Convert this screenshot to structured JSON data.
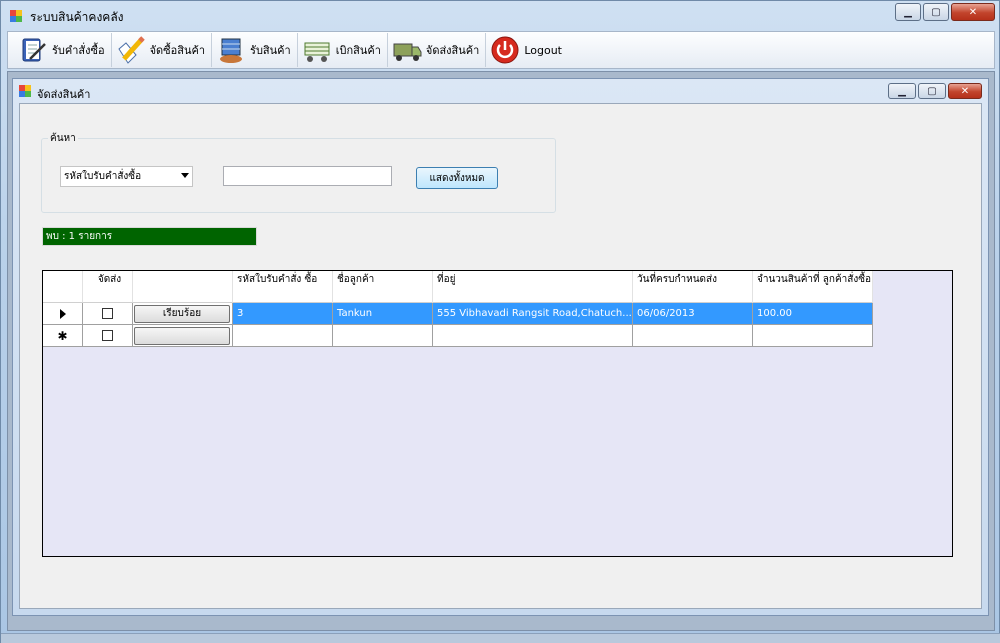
{
  "app": {
    "title": "ระบบสินค้าคงคลัง"
  },
  "window_controls": {
    "minimize": "▁",
    "maximize": "▢",
    "close": "✕"
  },
  "toolbar": {
    "items": [
      {
        "label": "รับคำสั่งซื้อ",
        "icon": "notebook-pen-icon"
      },
      {
        "label": "จัดซื้อสินค้า",
        "icon": "pencil-checklist-icon"
      },
      {
        "label": "รับสินค้า",
        "icon": "receive-goods-icon"
      },
      {
        "label": "เบิกสินค้า",
        "icon": "trolley-icon"
      },
      {
        "label": "จัดส่งสินค้า",
        "icon": "delivery-truck-icon"
      },
      {
        "label": "Logout",
        "icon": "power-icon"
      }
    ]
  },
  "child_window": {
    "title": "จัดส่งสินค้า"
  },
  "search": {
    "group_label": "ค้นหา",
    "combo_selected": "รหัสใบรับคำสั่งซื้อ",
    "text_value": "",
    "show_all_label": "แสดงทั้งหมด"
  },
  "result": {
    "found_text": "พบ : 1 รายการ"
  },
  "grid": {
    "headers": [
      "จัดส่ง",
      "",
      "รหัสใบรับคำสั่ง ซื้อ",
      "ชื่อลูกค้า",
      "ที่อยู่",
      "วันที่ครบกำหนดส่ง",
      "จำนวนสินค้าที่ ลูกค้าสั่งซื้อ"
    ],
    "rows": [
      {
        "checked": false,
        "button_label": "เรียบร้อย",
        "order_id": "3",
        "customer": "Tankun",
        "address": "555 Vibhavadi Rangsit Road,Chatuch...",
        "due_date": "06/06/2013",
        "quantity": "100.00"
      }
    ],
    "new_row_marker": "✱",
    "new_row_button": ""
  },
  "colors": {
    "found_bar": "#006400",
    "selection": "#3399ff",
    "grid_bg": "#e6e6f6"
  }
}
